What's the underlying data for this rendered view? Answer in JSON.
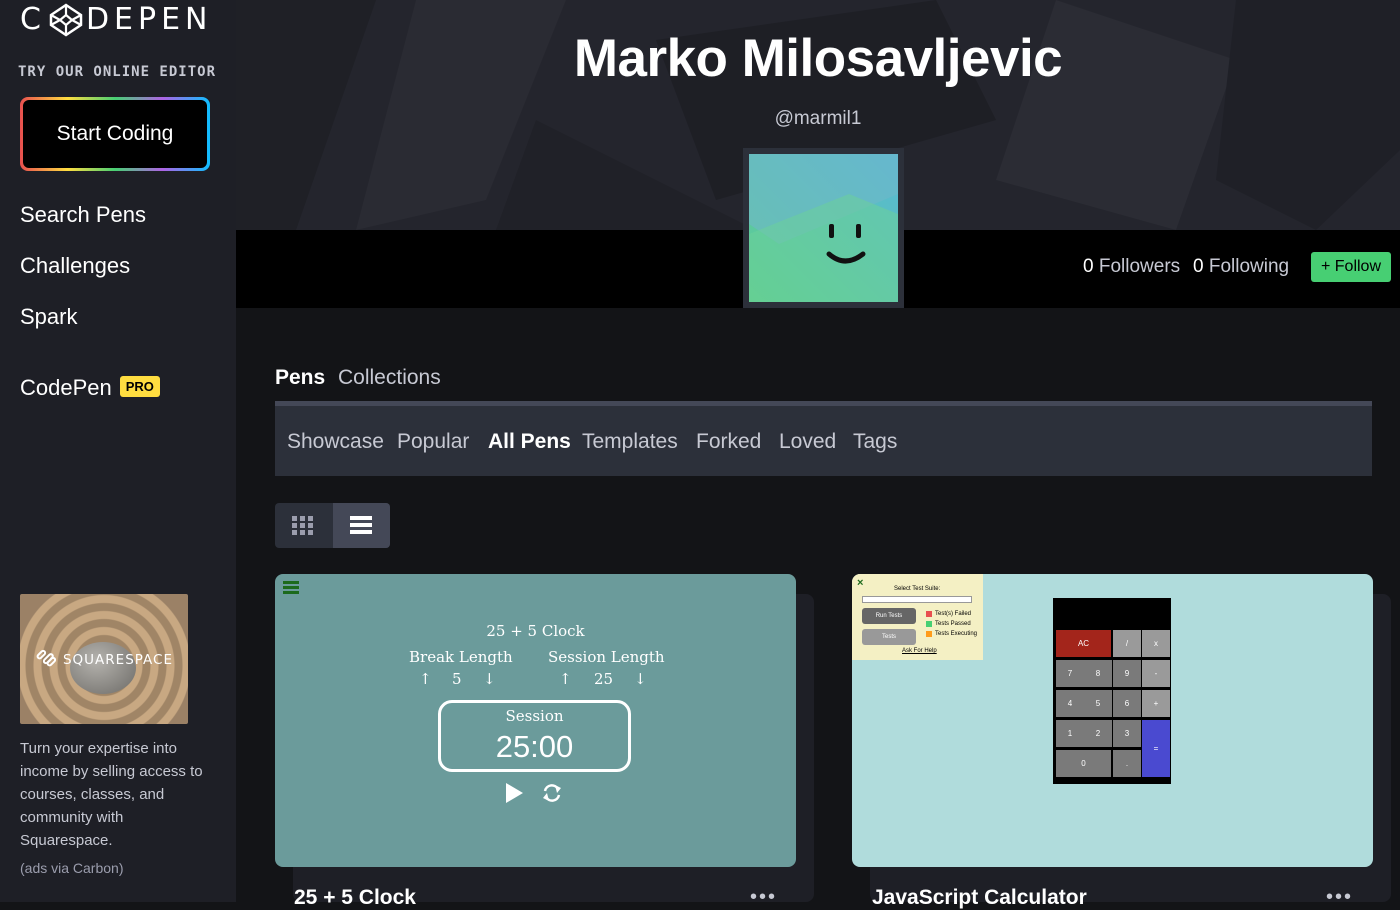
{
  "sidebar": {
    "logo_text_c": "C",
    "logo_text_rest": "DEPEN",
    "tagline": "TRY OUR ONLINE EDITOR",
    "start_button": "Start Coding",
    "nav": [
      "Search Pens",
      "Challenges",
      "Spark"
    ],
    "codepen_label": "CodePen",
    "pro_badge": "PRO",
    "ad": {
      "brand": "SQUARESPACE",
      "text": "Turn your expertise into income by selling access to courses, classes, and community with Squarespace.",
      "via": "(ads via Carbon)"
    }
  },
  "profile": {
    "name": "Marko Milosavljevic",
    "handle": "@marmil1",
    "followers_count": "0",
    "followers_label": "Followers",
    "following_count": "0",
    "following_label": "Following",
    "follow_button": "+ Follow"
  },
  "tabs": [
    {
      "label": "Pens",
      "active": true
    },
    {
      "label": "Collections",
      "active": false
    }
  ],
  "subnav": [
    {
      "label": "Showcase"
    },
    {
      "label": "Popular"
    },
    {
      "label": "All Pens",
      "active": true
    },
    {
      "label": "Templates"
    },
    {
      "label": "Forked"
    },
    {
      "label": "Loved"
    },
    {
      "label": "Tags"
    }
  ],
  "view_toggle": {
    "active": "list"
  },
  "pens": [
    {
      "title": "25 + 5 Clock",
      "preview": {
        "heading": "25 + 5 Clock",
        "break_label": "Break Length",
        "break_value": "5",
        "session_label": "Session Length",
        "session_value": "25",
        "timer_label": "Session",
        "timer_value": "25:00"
      }
    },
    {
      "title": "JavaScript Calculator",
      "preview": {
        "test_suite_label": "Select Test Suite:",
        "run_tests": "Run Tests",
        "tests": "Tests",
        "legend": [
          "Test(s) Failed",
          "Tests Passed",
          "Tests Executing"
        ],
        "help_link": "Ask For Help",
        "keys": [
          "AC",
          "/",
          "x",
          "7",
          "8",
          "9",
          "-",
          "4",
          "5",
          "6",
          "+",
          "1",
          "2",
          "3",
          "=",
          "0",
          "."
        ]
      }
    }
  ],
  "colors": {
    "accent_green": "#47cf73",
    "pro_yellow": "#ffdd40",
    "clock_bg": "#6b9b9b",
    "calc_bg": "#b0dcdc"
  }
}
